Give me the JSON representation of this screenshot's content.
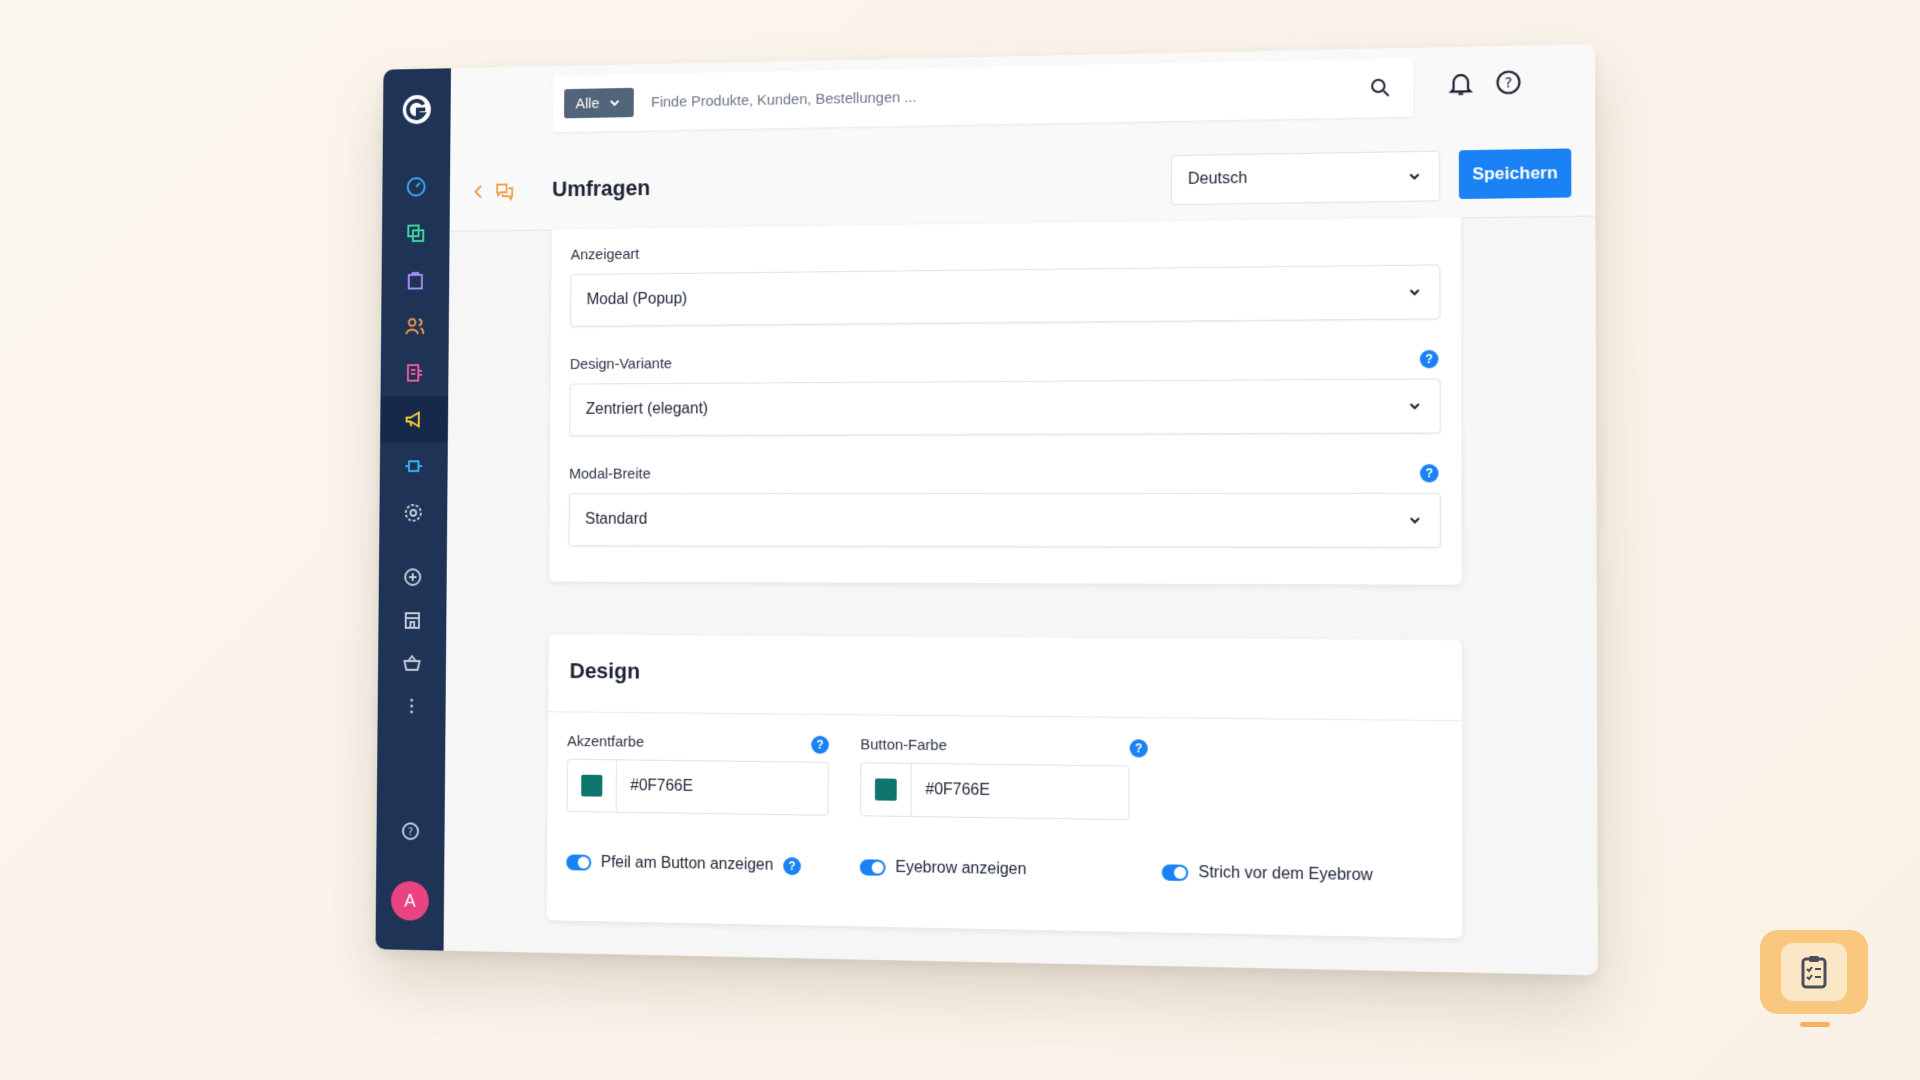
{
  "sidebar": {
    "logo": "G",
    "icons": [
      "dashboard-icon",
      "catalog-icon",
      "orders-icon",
      "customers-icon",
      "content-icon",
      "marketing-icon",
      "extensions-icon",
      "settings-icon",
      "add-icon",
      "store-icon",
      "basket-icon",
      "more-icon",
      "help-icon"
    ],
    "avatar_letter": "A",
    "colors": {
      "background": "#1f3356",
      "active": "#17294a",
      "avatar": "#e94384"
    }
  },
  "search": {
    "filter_label": "Alle",
    "placeholder": "Finde Produkte, Kunden, Bestellungen ..."
  },
  "header": {
    "title": "Umfragen",
    "language": "Deutsch",
    "save_label": "Speichern"
  },
  "settings": {
    "display_type": {
      "label": "Anzeigeart",
      "value": "Modal (Popup)"
    },
    "design_variant": {
      "label": "Design-Variante",
      "value": "Zentriert (elegant)"
    },
    "modal_width": {
      "label": "Modal-Breite",
      "value": "Standard"
    }
  },
  "design": {
    "title": "Design",
    "accent_color": {
      "label": "Akzentfarbe",
      "value": "#0F766E"
    },
    "button_color": {
      "label": "Button-Farbe",
      "value": "#0F766E"
    },
    "toggles": [
      {
        "label": "Pfeil am Button anzeigen",
        "on": true
      },
      {
        "label": "Eyebrow anzeigen",
        "on": true
      },
      {
        "label": "Strich vor dem Eyebrow",
        "on": true
      }
    ]
  },
  "colors": {
    "primary": "#1a82f4",
    "swatch": "#0F766E",
    "fab": "#f9c77e"
  }
}
